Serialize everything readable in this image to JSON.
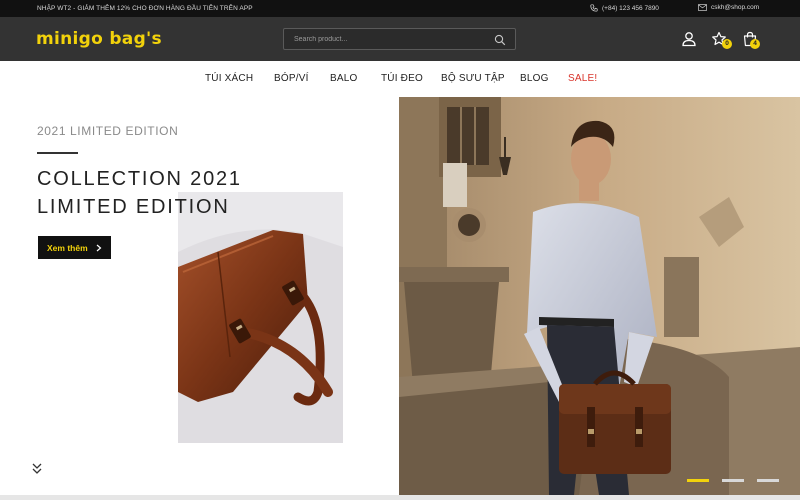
{
  "topbar": {
    "promo": "NHẬP WT2 - GIẢM THÊM 12% CHO ĐƠN HÀNG ĐẦU TIÊN TRÊN APP",
    "phone": "(+84) 123 456 7890",
    "email": "cskh@shop.com"
  },
  "header": {
    "logo": "minigo bag's",
    "search_placeholder": "Search product...",
    "wishlist_count": "0",
    "cart_count": "4"
  },
  "nav": {
    "items": [
      "TÚI XÁCH",
      "BÓP/VÍ",
      "BALO",
      "TÚI ĐEO",
      "BỘ SƯU TẬP",
      "BLOG",
      "SALE!"
    ]
  },
  "hero": {
    "edition": "2021 LIMITED EDITION",
    "headline_line1": "COLLECTION 2021",
    "headline_line2": "LIMITED EDITION",
    "cta": "Xem thêm"
  },
  "slider": {
    "slides": 3,
    "active": 1
  },
  "colors": {
    "accent": "#f2d20b",
    "sale": "#d9342b",
    "header_bg": "#333333",
    "topbar_bg": "#111111"
  }
}
